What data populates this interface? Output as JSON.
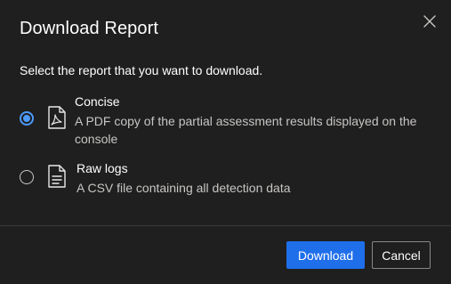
{
  "dialog": {
    "title": "Download Report",
    "subtitle": "Select the report that you want to download.",
    "options": [
      {
        "title": "Concise",
        "description": "A PDF copy of the partial assessment results displayed on the console",
        "icon": "pdf-file-icon",
        "selected": true
      },
      {
        "title": "Raw logs",
        "description": "A CSV file containing all detection data",
        "icon": "document-icon",
        "selected": false
      }
    ],
    "buttons": {
      "download_label": "Download",
      "cancel_label": "Cancel"
    }
  },
  "colors": {
    "background": "#1f1f1f",
    "accent": "#1f6fea",
    "radio_selected": "#4c9aff",
    "secondary_text": "#c8c6c4"
  }
}
